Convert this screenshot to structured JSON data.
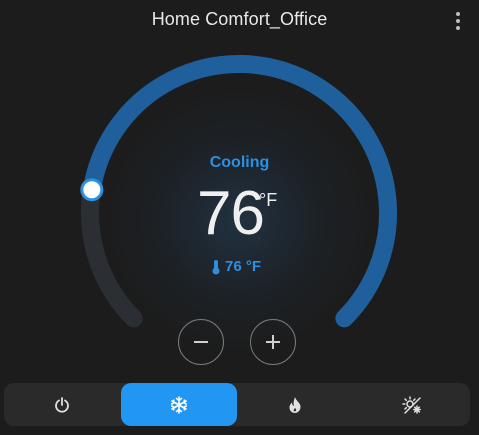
{
  "card": {
    "title": "Home Comfort_Office",
    "menu_icon": "dots-vertical-icon"
  },
  "thermostat": {
    "state": "Cooling",
    "target_temperature": "76",
    "unit": "°F",
    "current_temperature": "76 °F",
    "current_icon": "thermometer-icon",
    "setpoint_fraction": 0.2,
    "colors": {
      "accent": "#2d8fe0",
      "arc_active": "#1e5f9c",
      "arc_track": "#2b2f33"
    }
  },
  "controls": {
    "decrease_icon": "minus-icon",
    "increase_icon": "plus-icon"
  },
  "modes": [
    {
      "name": "off",
      "icon": "power-icon",
      "active": false
    },
    {
      "name": "cool",
      "icon": "snowflake-icon",
      "active": true
    },
    {
      "name": "heat",
      "icon": "flame-icon",
      "active": false
    },
    {
      "name": "auto",
      "icon": "sun-snowflake-icon",
      "active": false
    }
  ]
}
